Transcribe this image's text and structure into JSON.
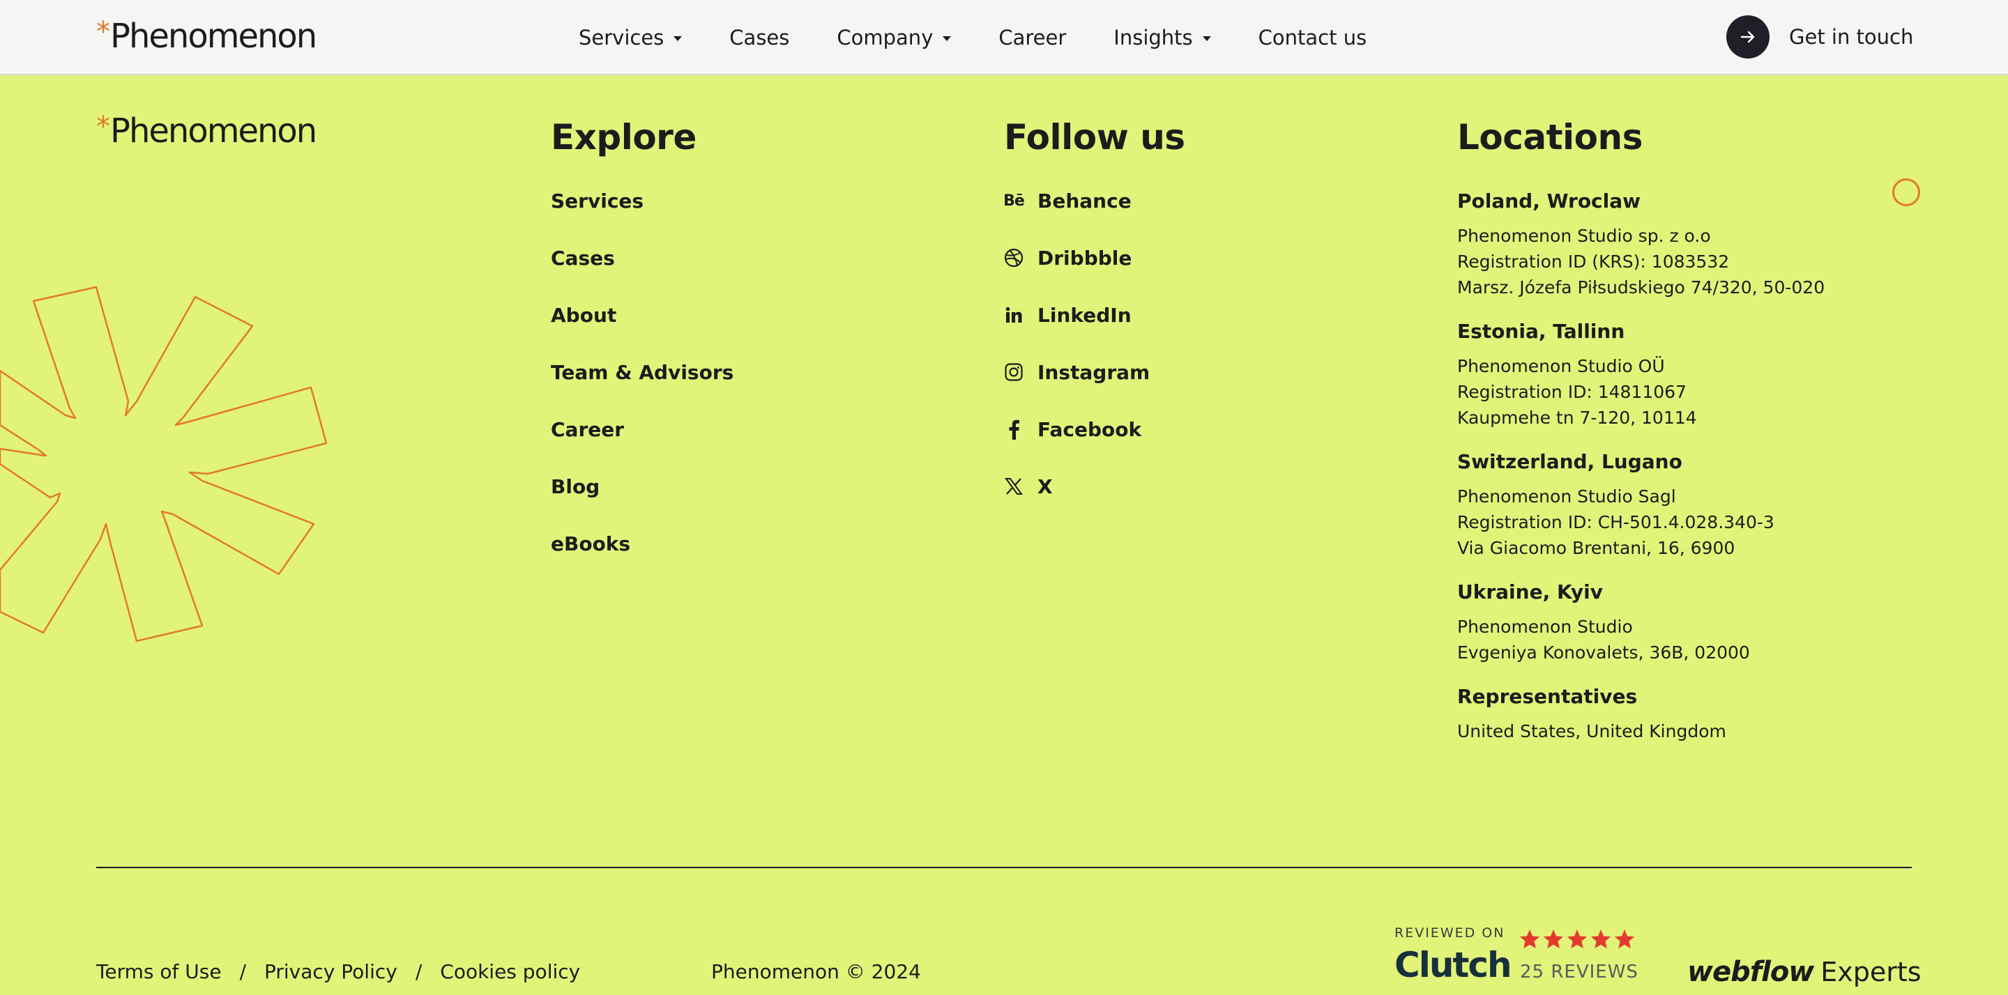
{
  "brand": {
    "logo_star": "*",
    "logo_text": "Phenomenon",
    "accent_color": "#e3782f",
    "background_color": "#e2f37a"
  },
  "nav": {
    "items": [
      {
        "label": "Services",
        "has_dropdown": true
      },
      {
        "label": "Cases",
        "has_dropdown": false
      },
      {
        "label": "Company",
        "has_dropdown": true
      },
      {
        "label": "Career",
        "has_dropdown": false
      },
      {
        "label": "Insights",
        "has_dropdown": true
      },
      {
        "label": "Contact us",
        "has_dropdown": false
      }
    ],
    "cta_label": "Get in touch",
    "cta_icon": "arrow-right-icon"
  },
  "footer": {
    "explore": {
      "title": "Explore",
      "links": [
        "Services",
        "Cases",
        "About",
        "Team & Advisors",
        "Career",
        "Blog",
        "eBooks"
      ]
    },
    "follow": {
      "title": "Follow us",
      "links": [
        {
          "label": "Behance",
          "icon": "behance-icon"
        },
        {
          "label": "Dribbble",
          "icon": "dribbble-icon"
        },
        {
          "label": "LinkedIn",
          "icon": "linkedin-icon"
        },
        {
          "label": "Instagram",
          "icon": "instagram-icon"
        },
        {
          "label": "Facebook",
          "icon": "facebook-icon"
        },
        {
          "label": "X",
          "icon": "x-icon"
        }
      ]
    },
    "locations": {
      "title": "Locations",
      "items": [
        {
          "name": "Poland, Wroclaw",
          "lines": [
            "Phenomenon Studio sp. z o.o",
            "Registration ID (KRS): 1083532",
            "Marsz. Józefa Piłsudskiego 74/320, 50-020"
          ]
        },
        {
          "name": "Estonia, Tallinn",
          "lines": [
            "Phenomenon Studio OÜ",
            "Registration ID: 14811067",
            "Kaupmehe tn 7-120, 10114"
          ]
        },
        {
          "name": "Switzerland, Lugano",
          "lines": [
            "Phenomenon Studio Sagl",
            "Registration ID: CH-501.4.028.340-3",
            "Via Giacomo Brentani, 16, 6900"
          ]
        },
        {
          "name": "Ukraine, Kyiv",
          "lines": [
            "Phenomenon Studio",
            "Evgeniya Konovalets, 36B, 02000"
          ]
        },
        {
          "name": "Representatives",
          "lines": [
            "United States, United Kingdom"
          ]
        }
      ]
    },
    "legal": {
      "terms": "Terms of Use",
      "privacy": "Privacy Policy",
      "cookies": "Cookies policy",
      "separator": "/"
    },
    "copyright": "Phenomenon © 2024",
    "clutch": {
      "reviewed_on": "REVIEWED ON",
      "brand": "Clutch",
      "stars": 5,
      "reviews": "25 REVIEWS",
      "star_color": "#e23b2e"
    },
    "webflow": {
      "brand": "webflow",
      "suffix": "Experts"
    }
  }
}
